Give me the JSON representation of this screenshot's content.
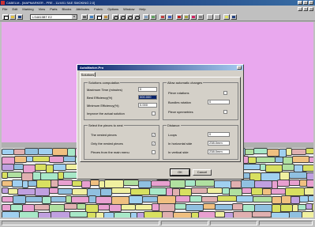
{
  "window": {
    "title": "CABELM - [MAPMARKER - PRE - 11/4/01 SAE SMOKING 2.0]"
  },
  "menu": {
    "items": [
      "File",
      "Edit",
      "Marking",
      "View",
      "Parts",
      "Blocks",
      "Attributes",
      "Fabric",
      "Options",
      "Window",
      "Help"
    ]
  },
  "toolbar": {
    "combo_value": "LS4815BT E2"
  },
  "dialog": {
    "title": "AutoMarker-Pro",
    "tab": "Solutions",
    "groups": {
      "solutions": "Solutions computation",
      "allow": "Allow automatic changes",
      "select": "Select the pieces to nest",
      "distance": "Distance"
    },
    "fields": {
      "max_time": {
        "label": "Maximum Time (minutes)",
        "value": "0"
      },
      "best_eff": {
        "label": "Best Efficiency(%)",
        "value": "000.000"
      },
      "min_eff": {
        "label": "Minimum Efficiency(%)",
        "value": "0.000"
      },
      "improve": {
        "label": "Improve the actual solution"
      },
      "piece_rotations": {
        "label": "Piece rotations"
      },
      "bundles_rotation": {
        "label": "Bundles rotation",
        "value": "0"
      },
      "piece_symmetries": {
        "label": "Piece symmetries"
      },
      "nested_pieces": {
        "label": "The nested pieces"
      },
      "only_nested": {
        "label": "Only the nested pieces"
      },
      "pieces_main": {
        "label": "Pieces from the main menu"
      },
      "loops": {
        "label": "Loops",
        "value": "0"
      },
      "horizontal": {
        "label": "In horizontal side",
        "value": "238.0mm"
      },
      "vertical": {
        "label": "In vertical side",
        "value": "238.0mm"
      }
    },
    "buttons": {
      "ok": "OK",
      "cancel": "Cancel"
    }
  },
  "colors": {
    "canvas": "#e9a8ee",
    "title_start": "#0a246a",
    "title_end": "#3a6ea5",
    "dialog_bg": "#d4d0c8"
  }
}
